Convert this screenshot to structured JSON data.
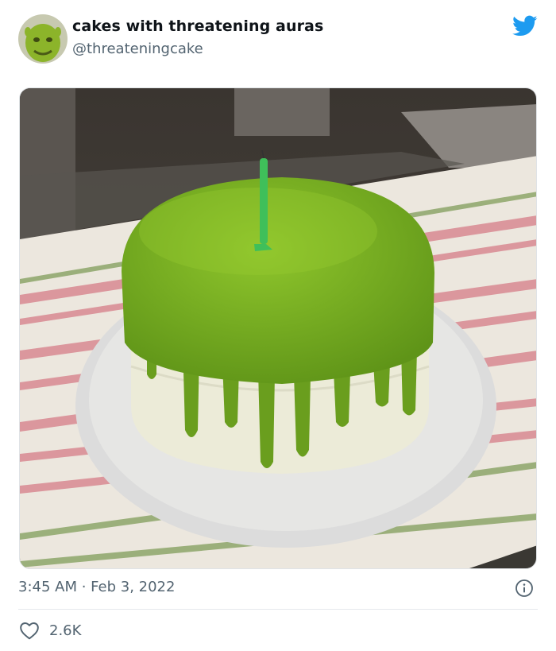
{
  "tweet": {
    "author_name": "cakes with threatening auras",
    "author_handle": "@threateningcake",
    "timestamp": "3:45 AM · Feb 3, 2022",
    "likes": "2.6K"
  },
  "icons": {
    "brand": "twitter-bird-icon",
    "info": "info-icon",
    "like": "heart-icon"
  },
  "colors": {
    "twitter_blue": "#1d9bf0",
    "muted_text": "#536471",
    "icing_green": "#7fb320"
  }
}
